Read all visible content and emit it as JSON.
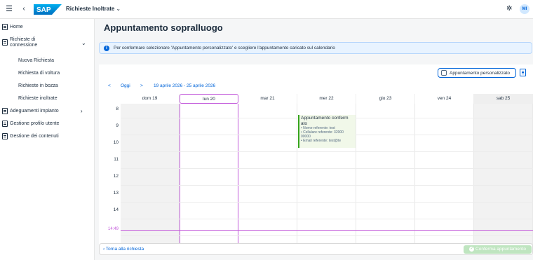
{
  "shell": {
    "menu_icon": "menu-icon",
    "back_icon": "back-icon",
    "logo_text": "SAP",
    "app_title": "Richieste Inoltrate",
    "app_title_chevron": "⌄",
    "user_initials": "MI"
  },
  "sidebar": {
    "items": [
      {
        "label": "Home",
        "icon": "document-icon"
      },
      {
        "label": "Richieste di connessione",
        "label_line1": "Richieste di",
        "label_line2": "connessione",
        "icon": "document-icon"
      },
      {
        "label": "Nuova Richiesta"
      },
      {
        "label": "Richiesta di voltura"
      },
      {
        "label": "Richieste in bozza"
      },
      {
        "label": "Richieste inoltrate"
      },
      {
        "label": "Adeguamenti impianto",
        "icon": "document-icon"
      },
      {
        "label": "Gestione profilo utente",
        "icon": "document-icon"
      },
      {
        "label": "Gestione dei contenuti",
        "icon": "document-icon"
      }
    ]
  },
  "main": {
    "title": "Appuntamento sopralluogo",
    "info_text": "Per confermare selezionare 'Appuntamento personalizzato' e scegliere l'appuntamento caricato sul calendario",
    "custom_appointment_label": "Appuntamento personalizzato",
    "custom_appointment_checked": false
  },
  "calendar": {
    "nav": {
      "prev": "<",
      "today": "Oggi",
      "next": ">",
      "range": "19 aprile 2026 - 25 aprile 2026"
    },
    "days": [
      "dom 19",
      "lun 20",
      "mar 21",
      "mer 22",
      "gio 23",
      "ven 24",
      "sab 25"
    ],
    "today_index": 1,
    "hours": [
      "8",
      "9",
      "10",
      "11",
      "12",
      "13",
      "14"
    ],
    "current_time": "14:49",
    "appointment": {
      "title": "Appuntamento confermato",
      "title_line1": "Appuntamento conferm",
      "title_line2": "ato",
      "details": [
        "• Nome referente: test",
        "• Cellulare referente: 32000",
        "00000",
        "• Email referente: test@te"
      ],
      "status_color": "#36a41d"
    }
  },
  "footer": {
    "back_label": "Torna alla richiesta",
    "confirm_label": "Conferma appuntamento",
    "confirm_enabled": false
  },
  "colors": {
    "accent": "#0064d9",
    "today_highlight": "#c35bdb",
    "info_bg": "#e8f3ff"
  }
}
